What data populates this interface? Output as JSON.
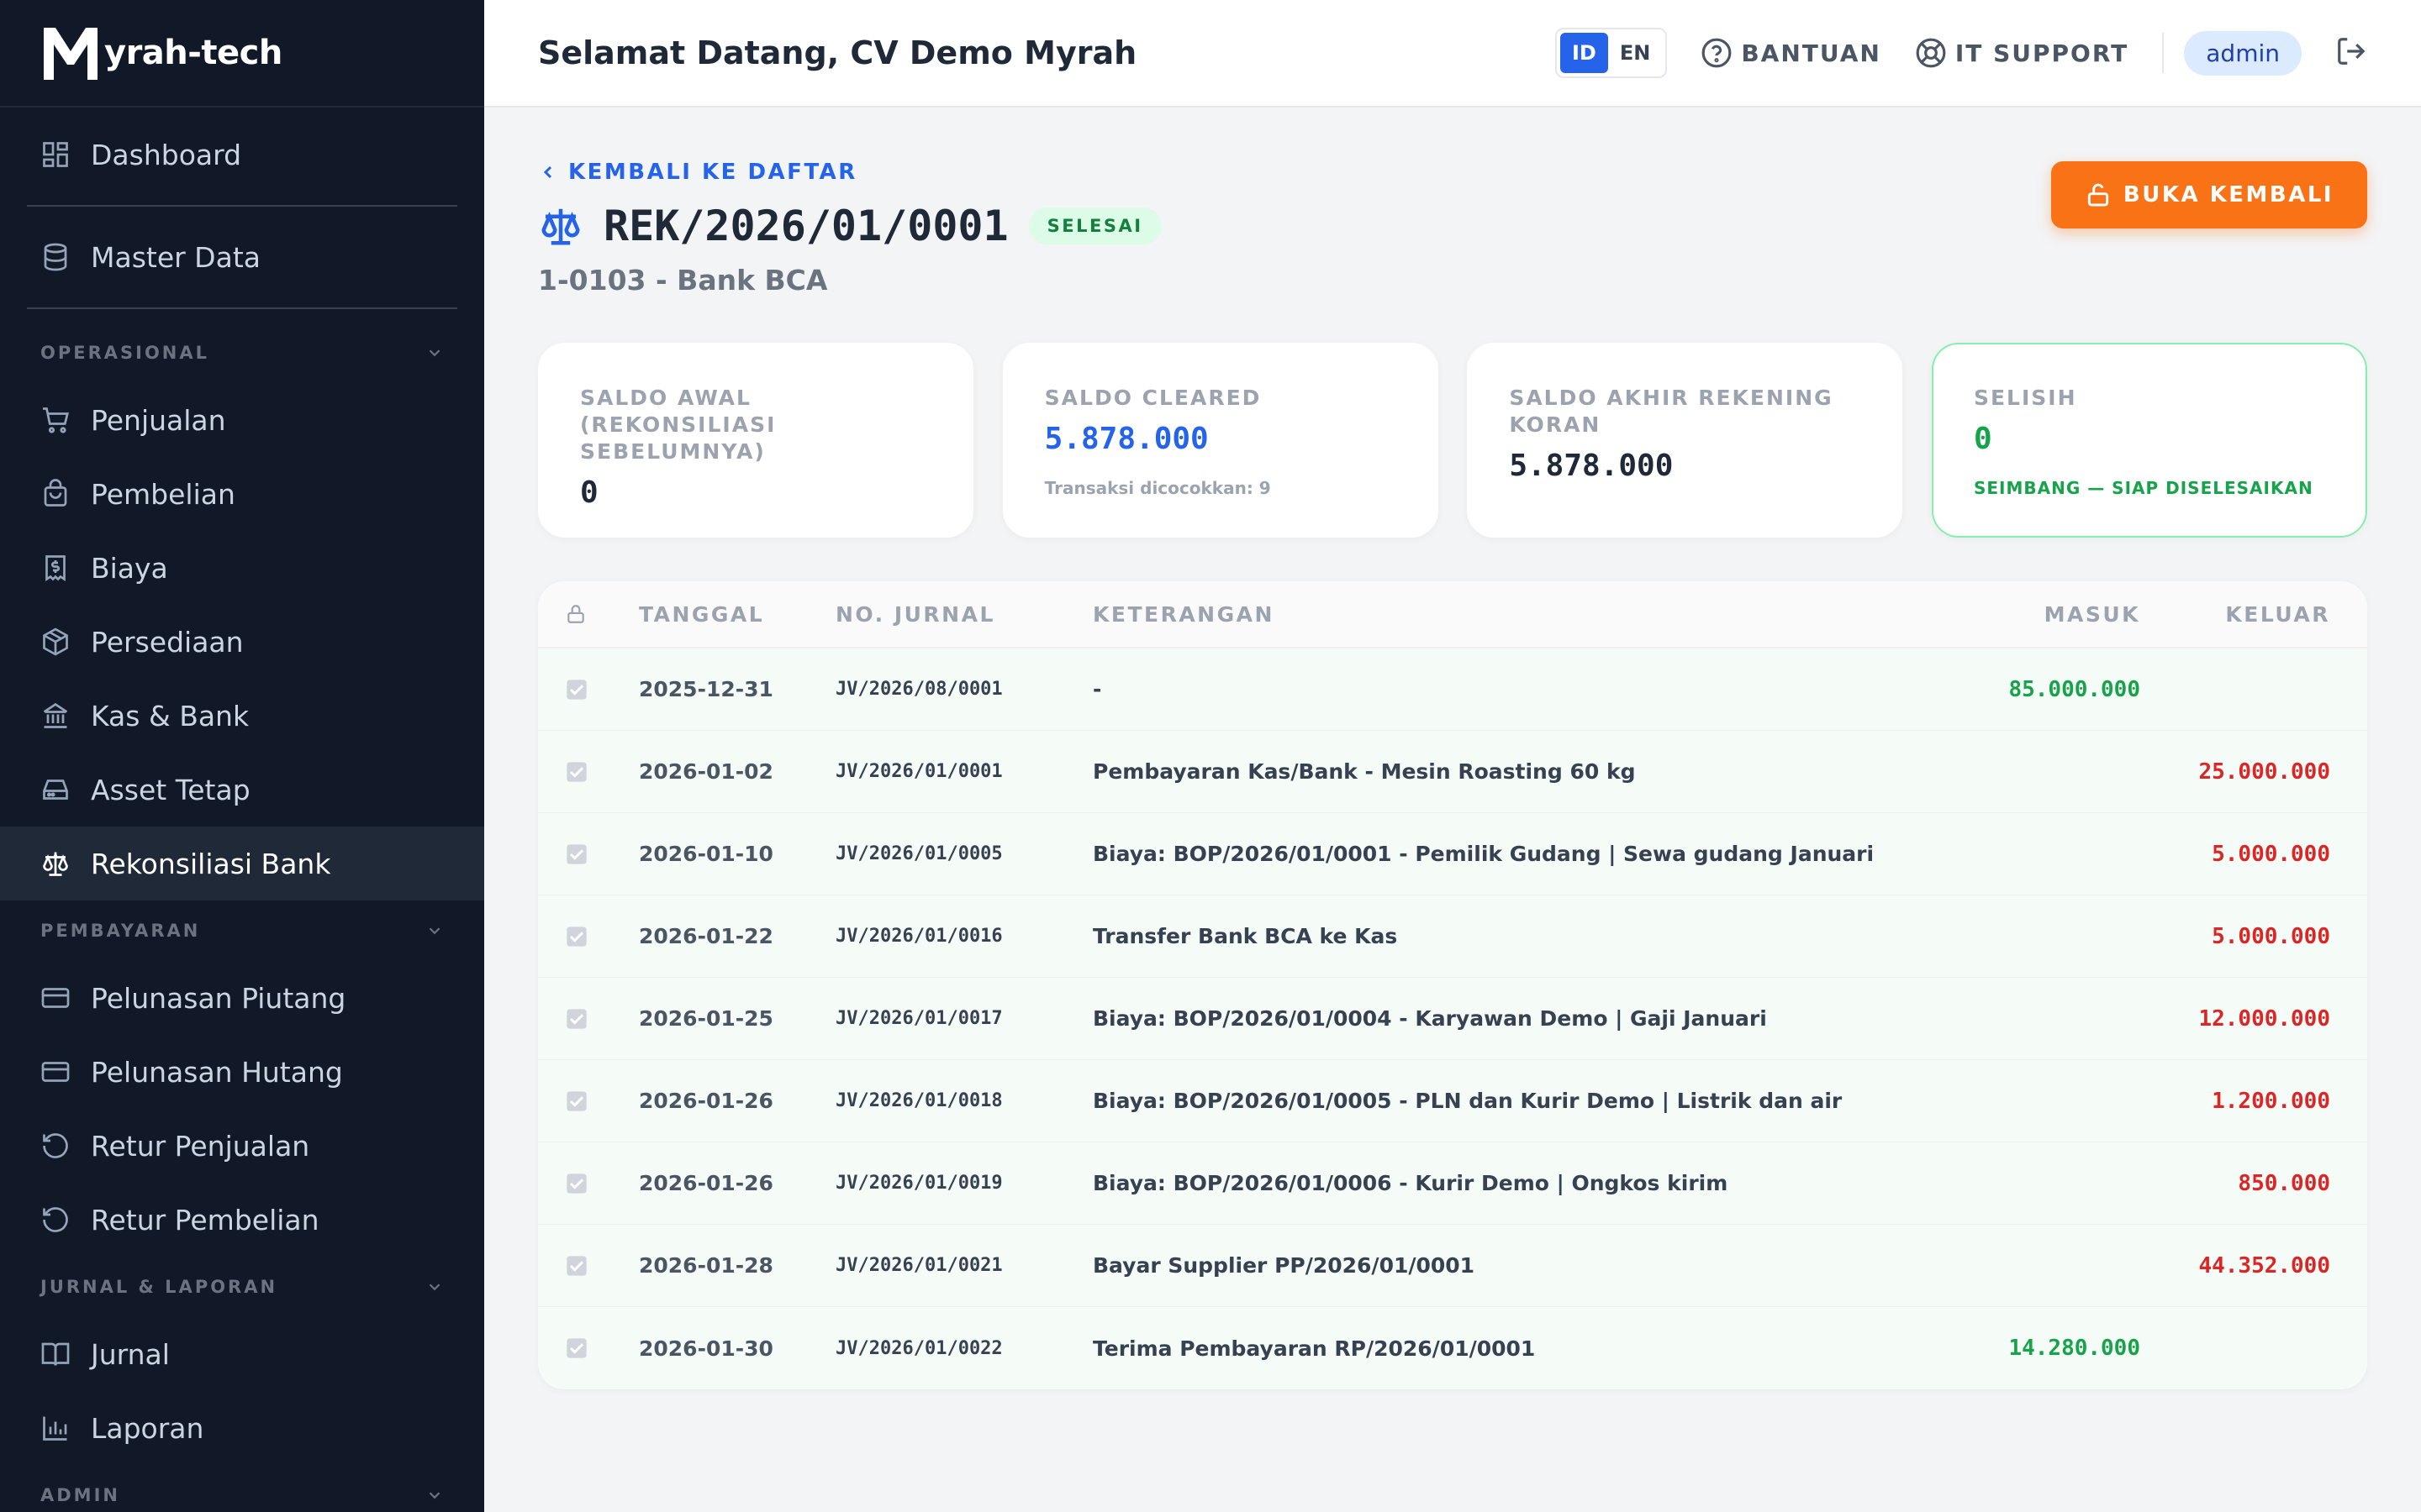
{
  "brand": {
    "name": "yrah-tech"
  },
  "sidebar": {
    "top_items": [
      {
        "label": "Dashboard",
        "icon": "dashboard-icon"
      },
      {
        "label": "Master Data",
        "icon": "database-icon"
      }
    ],
    "sections": [
      {
        "title": "OPERASIONAL",
        "items": [
          "Penjualan",
          "Pembelian",
          "Biaya",
          "Persediaan",
          "Kas & Bank",
          "Asset Tetap",
          "Rekonsiliasi Bank"
        ]
      },
      {
        "title": "PEMBAYARAN",
        "items": [
          "Pelunasan Piutang",
          "Pelunasan Hutang",
          "Retur Penjualan",
          "Retur Pembelian"
        ]
      },
      {
        "title": "JURNAL & LAPORAN",
        "items": [
          "Jurnal",
          "Laporan"
        ]
      },
      {
        "title": "ADMIN",
        "items": []
      }
    ],
    "active": "Rekonsiliasi Bank"
  },
  "topbar": {
    "welcome": "Selamat Datang, CV Demo Myrah",
    "lang": {
      "id": "ID",
      "en": "EN",
      "selected": "ID"
    },
    "help": "BANTUAN",
    "support": "IT SUPPORT",
    "user": "admin"
  },
  "page": {
    "back": "KEMBALI KE DAFTAR",
    "doc_no": "REK/2026/01/0001",
    "status": "SELESAI",
    "account": "1-0103 - Bank BCA",
    "reopen": "BUKA KEMBALI"
  },
  "cards": [
    {
      "label": "SALDO AWAL (REKONSILIASI SEBELUMNYA)",
      "value": "0",
      "note": ""
    },
    {
      "label": "SALDO CLEARED",
      "value": "5.878.000",
      "note": "Transaksi dicocokkan: 9"
    },
    {
      "label": "SALDO AKHIR REKENING KORAN",
      "value": "5.878.000",
      "note": ""
    },
    {
      "label": "SELISIH",
      "value": "0",
      "note": "SEIMBANG — SIAP DISELESAIKAN"
    }
  ],
  "table": {
    "headers": {
      "date": "TANGGAL",
      "jv": "NO. JURNAL",
      "desc": "KETERANGAN",
      "in": "MASUK",
      "out": "KELUAR"
    },
    "rows": [
      {
        "date": "2025-12-31",
        "jv": "JV/2026/08/0001",
        "desc": "-",
        "in": "85.000.000",
        "out": "",
        "checked": true
      },
      {
        "date": "2026-01-02",
        "jv": "JV/2026/01/0001",
        "desc": "Pembayaran Kas/Bank - Mesin Roasting 60 kg",
        "in": "",
        "out": "25.000.000",
        "checked": true
      },
      {
        "date": "2026-01-10",
        "jv": "JV/2026/01/0005",
        "desc": "Biaya: BOP/2026/01/0001 - Pemilik Gudang | Sewa gudang Januari",
        "in": "",
        "out": "5.000.000",
        "checked": true
      },
      {
        "date": "2026-01-22",
        "jv": "JV/2026/01/0016",
        "desc": "Transfer Bank BCA ke Kas",
        "in": "",
        "out": "5.000.000",
        "checked": true
      },
      {
        "date": "2026-01-25",
        "jv": "JV/2026/01/0017",
        "desc": "Biaya: BOP/2026/01/0004 - Karyawan Demo | Gaji Januari",
        "in": "",
        "out": "12.000.000",
        "checked": true
      },
      {
        "date": "2026-01-26",
        "jv": "JV/2026/01/0018",
        "desc": "Biaya: BOP/2026/01/0005 - PLN dan Kurir Demo | Listrik dan air",
        "in": "",
        "out": "1.200.000",
        "checked": true
      },
      {
        "date": "2026-01-26",
        "jv": "JV/2026/01/0019",
        "desc": "Biaya: BOP/2026/01/0006 - Kurir Demo | Ongkos kirim",
        "in": "",
        "out": "850.000",
        "checked": true
      },
      {
        "date": "2026-01-28",
        "jv": "JV/2026/01/0021",
        "desc": "Bayar Supplier PP/2026/01/0001",
        "in": "",
        "out": "44.352.000",
        "checked": true
      },
      {
        "date": "2026-01-30",
        "jv": "JV/2026/01/0022",
        "desc": "Terima Pembayaran RP/2026/01/0001",
        "in": "14.280.000",
        "out": "",
        "checked": true
      }
    ]
  },
  "colors": {
    "sidebar_bg": "#111827",
    "accent": "#2563eb",
    "orange": "#f97316",
    "green": "#16a34a",
    "red": "#dc2626"
  }
}
